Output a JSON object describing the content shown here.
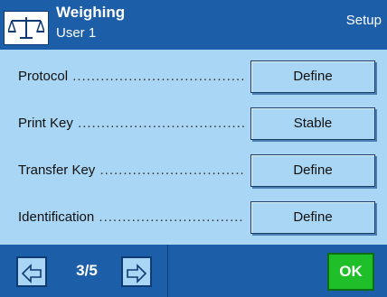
{
  "header": {
    "title": "Weighing",
    "subtitle": "User 1",
    "setup_label": "Setup",
    "app_icon": "balance-scale-icon"
  },
  "rows": [
    {
      "label": "Protocol",
      "value": "Define"
    },
    {
      "label": "Print Key",
      "value": "Stable"
    },
    {
      "label": "Transfer Key",
      "value": "Define"
    },
    {
      "label": "Identification",
      "value": "Define"
    }
  ],
  "footer": {
    "prev_icon": "arrow-left-icon",
    "next_icon": "arrow-right-icon",
    "page_indicator": "3/5",
    "ok_label": "OK"
  },
  "colors": {
    "header_bg": "#1c5ea8",
    "content_bg": "#a9d6f4",
    "ok_bg": "#1fbf2a"
  }
}
